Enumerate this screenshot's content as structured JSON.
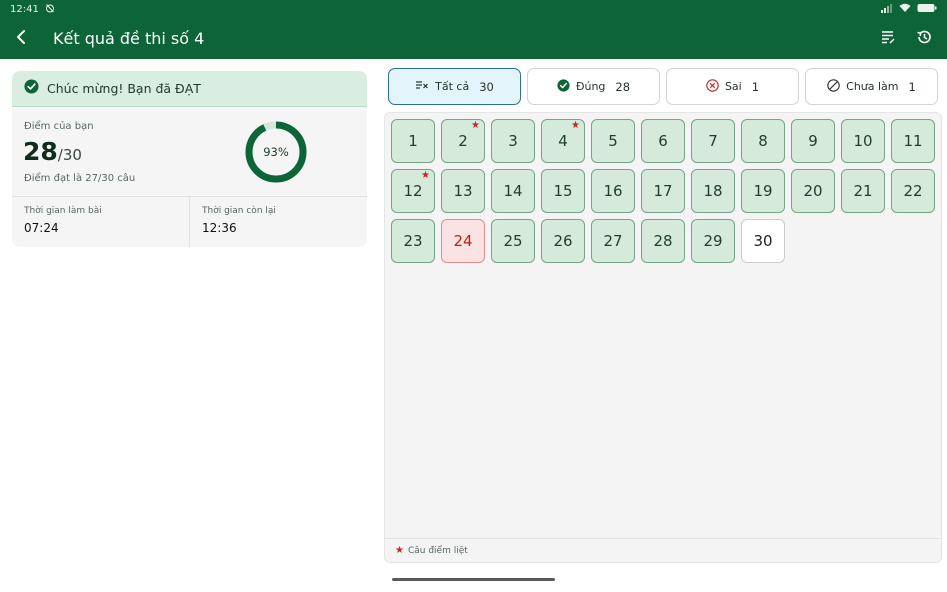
{
  "status_bar": {
    "time": "12:41"
  },
  "app_bar": {
    "title": "Kết quả đề thi số 4"
  },
  "result": {
    "message": "Chúc mừng! Bạn đã ĐẠT",
    "score_label": "Điểm của bạn",
    "score": "28",
    "score_total": "/30",
    "pass_text": "Điểm đạt là 27/30 câu",
    "percent_text": "93%",
    "percent_value": 93,
    "time_used_label": "Thời gian làm bài",
    "time_used": "07:24",
    "time_left_label": "Thời gian còn lại",
    "time_left": "12:36"
  },
  "filters": [
    {
      "label": "Tất cả",
      "count": "30",
      "icon": "list-check-icon",
      "active": true
    },
    {
      "label": "Đúng",
      "count": "28",
      "icon": "check-circle-icon",
      "active": false
    },
    {
      "label": "Sai",
      "count": "1",
      "icon": "x-circle-icon",
      "active": false
    },
    {
      "label": "Chưa làm",
      "count": "1",
      "icon": "ban-icon",
      "active": false
    }
  ],
  "questions": [
    {
      "n": "1",
      "status": "correct",
      "critical": false
    },
    {
      "n": "2",
      "status": "correct",
      "critical": true
    },
    {
      "n": "3",
      "status": "correct",
      "critical": false
    },
    {
      "n": "4",
      "status": "correct",
      "critical": true
    },
    {
      "n": "5",
      "status": "correct",
      "critical": false
    },
    {
      "n": "6",
      "status": "correct",
      "critical": false
    },
    {
      "n": "7",
      "status": "correct",
      "critical": false
    },
    {
      "n": "8",
      "status": "correct",
      "critical": false
    },
    {
      "n": "9",
      "status": "correct",
      "critical": false
    },
    {
      "n": "10",
      "status": "correct",
      "critical": false
    },
    {
      "n": "11",
      "status": "correct",
      "critical": false
    },
    {
      "n": "12",
      "status": "correct",
      "critical": true
    },
    {
      "n": "13",
      "status": "correct",
      "critical": false
    },
    {
      "n": "14",
      "status": "correct",
      "critical": false
    },
    {
      "n": "15",
      "status": "correct",
      "critical": false
    },
    {
      "n": "16",
      "status": "correct",
      "critical": false
    },
    {
      "n": "17",
      "status": "correct",
      "critical": false
    },
    {
      "n": "18",
      "status": "correct",
      "critical": false
    },
    {
      "n": "19",
      "status": "correct",
      "critical": false
    },
    {
      "n": "20",
      "status": "correct",
      "critical": false
    },
    {
      "n": "21",
      "status": "correct",
      "critical": false
    },
    {
      "n": "22",
      "status": "correct",
      "critical": false
    },
    {
      "n": "23",
      "status": "correct",
      "critical": false
    },
    {
      "n": "24",
      "status": "wrong",
      "critical": false
    },
    {
      "n": "25",
      "status": "correct",
      "critical": false
    },
    {
      "n": "26",
      "status": "correct",
      "critical": false
    },
    {
      "n": "27",
      "status": "correct",
      "critical": false
    },
    {
      "n": "28",
      "status": "correct",
      "critical": false
    },
    {
      "n": "29",
      "status": "correct",
      "critical": false
    },
    {
      "n": "30",
      "status": "unanswered",
      "critical": false
    }
  ],
  "legend": {
    "label": "Câu điểm liệt"
  },
  "colors": {
    "primary": "#0d6537",
    "correct_bg": "#d6eadc",
    "wrong_bg": "#fbe3e3",
    "critical_star": "#c62828",
    "ring_track": "#d5e6db"
  }
}
